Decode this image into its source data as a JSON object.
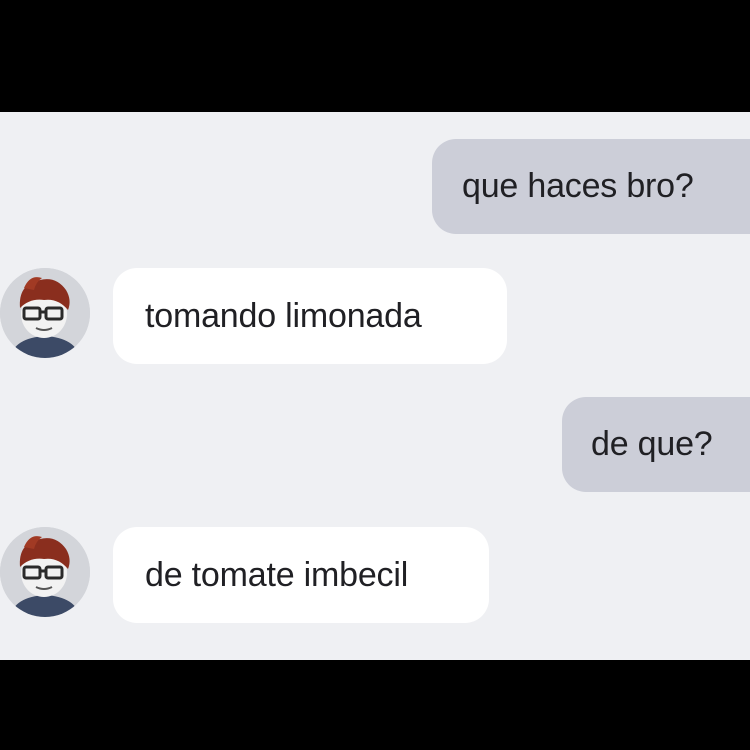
{
  "conversation": {
    "messages": [
      {
        "direction": "outgoing",
        "text": "que haces bro?"
      },
      {
        "direction": "incoming",
        "text": "tomando limonada",
        "avatar_icon": "roblox-avatar-icon"
      },
      {
        "direction": "outgoing",
        "text": "de que?"
      },
      {
        "direction": "incoming",
        "text": "de tomate imbecil",
        "avatar_icon": "roblox-avatar-icon"
      }
    ]
  },
  "colors": {
    "letterbox": "#000000",
    "chat_background": "#eff0f3",
    "outgoing_bubble": "#ccced8",
    "incoming_bubble": "#ffffff",
    "text": "#202024"
  }
}
